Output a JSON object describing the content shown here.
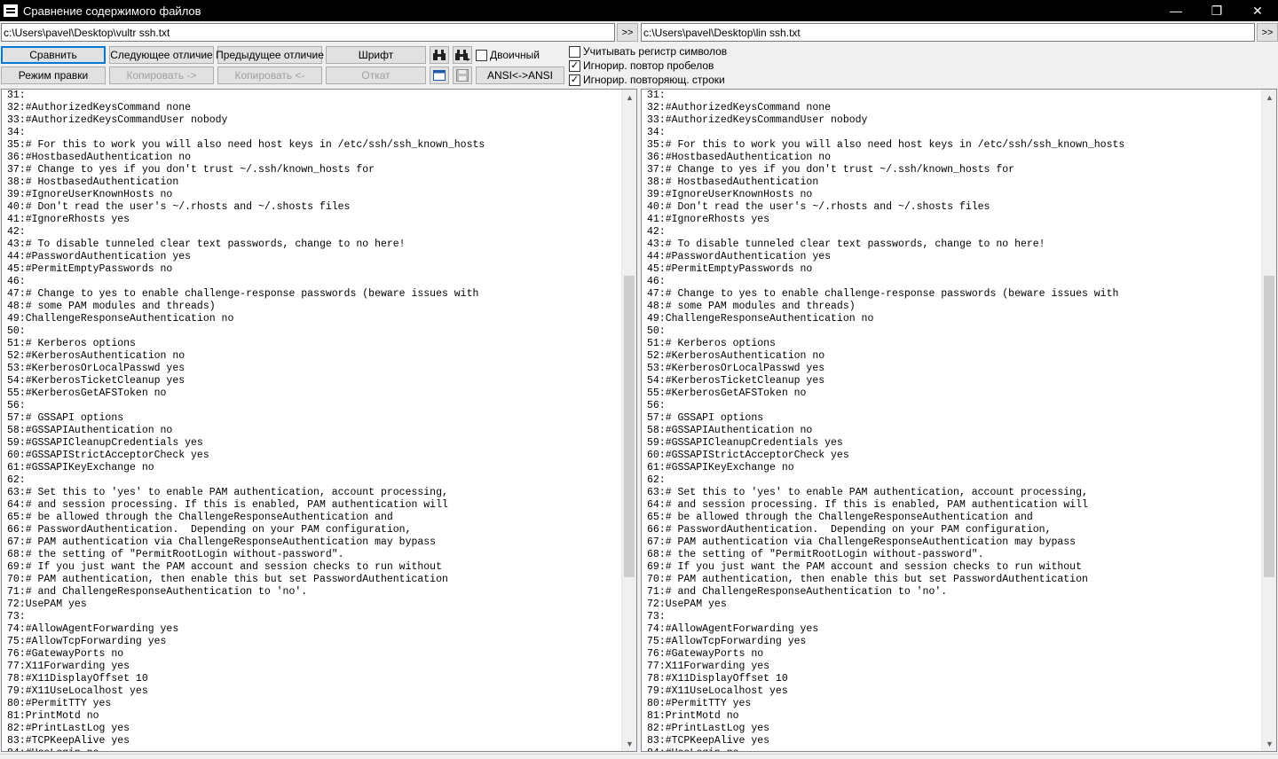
{
  "window": {
    "title": "Сравнение содержимого файлов",
    "min_glyph": "—",
    "max_glyph": "❐",
    "close_glyph": "✕"
  },
  "paths": {
    "left": "c:\\Users\\pavel\\Desktop\\vultr ssh.txt",
    "right": "c:\\Users\\pavel\\Desktop\\lin ssh.txt",
    "browse_label": ">>"
  },
  "toolbar": {
    "compare": "Сравнить",
    "next_diff": "Следующее отличие",
    "prev_diff": "Предыдущее отличие",
    "font": "Шрифт",
    "binary": "Двоичный",
    "edit_mode": "Режим правки",
    "copy_right": "Копировать ->",
    "copy_left": "Копировать <-",
    "undo": "Откат",
    "ansi": "ANSI<->ANSI",
    "find_icon": "binoculars-icon",
    "find_next_icon": "binoculars-next-icon",
    "view_icon": "window-icon",
    "save_icon": "floppy-disk-icon"
  },
  "options": {
    "case_sensitive": {
      "label": "Учитывать регистр символов",
      "checked": false
    },
    "ignore_spaces": {
      "label": "Игнорир. повтор пробелов",
      "checked": true
    },
    "ignore_lines": {
      "label": "Игнорир. повторяющ. строки",
      "checked": true
    }
  },
  "left_text": "31:\n32:#AuthorizedKeysCommand none\n33:#AuthorizedKeysCommandUser nobody\n34:\n35:# For this to work you will also need host keys in /etc/ssh/ssh_known_hosts\n36:#HostbasedAuthentication no\n37:# Change to yes if you don't trust ~/.ssh/known_hosts for\n38:# HostbasedAuthentication\n39:#IgnoreUserKnownHosts no\n40:# Don't read the user's ~/.rhosts and ~/.shosts files\n41:#IgnoreRhosts yes\n42:\n43:# To disable tunneled clear text passwords, change to no here!\n44:#PasswordAuthentication yes\n45:#PermitEmptyPasswords no\n46:\n47:# Change to yes to enable challenge-response passwords (beware issues with\n48:# some PAM modules and threads)\n49:ChallengeResponseAuthentication no\n50:\n51:# Kerberos options\n52:#KerberosAuthentication no\n53:#KerberosOrLocalPasswd yes\n54:#KerberosTicketCleanup yes\n55:#KerberosGetAFSToken no\n56:\n57:# GSSAPI options\n58:#GSSAPIAuthentication no\n59:#GSSAPICleanupCredentials yes\n60:#GSSAPIStrictAcceptorCheck yes\n61:#GSSAPIKeyExchange no\n62:\n63:# Set this to 'yes' to enable PAM authentication, account processing,\n64:# and session processing. If this is enabled, PAM authentication will\n65:# be allowed through the ChallengeResponseAuthentication and\n66:# PasswordAuthentication.  Depending on your PAM configuration,\n67:# PAM authentication via ChallengeResponseAuthentication may bypass\n68:# the setting of \"PermitRootLogin without-password\".\n69:# If you just want the PAM account and session checks to run without\n70:# PAM authentication, then enable this but set PasswordAuthentication\n71:# and ChallengeResponseAuthentication to 'no'.\n72:UsePAM yes\n73:\n74:#AllowAgentForwarding yes\n75:#AllowTcpForwarding yes\n76:#GatewayPorts no\n77:X11Forwarding yes\n78:#X11DisplayOffset 10\n79:#X11UseLocalhost yes\n80:#PermitTTY yes\n81:PrintMotd no\n82:#PrintLastLog yes\n83:#TCPKeepAlive yes\n84:#UseLogin no",
  "right_text": "31:\n32:#AuthorizedKeysCommand none\n33:#AuthorizedKeysCommandUser nobody\n34:\n35:# For this to work you will also need host keys in /etc/ssh/ssh_known_hosts\n36:#HostbasedAuthentication no\n37:# Change to yes if you don't trust ~/.ssh/known_hosts for\n38:# HostbasedAuthentication\n39:#IgnoreUserKnownHosts no\n40:# Don't read the user's ~/.rhosts and ~/.shosts files\n41:#IgnoreRhosts yes\n42:\n43:# To disable tunneled clear text passwords, change to no here!\n44:#PasswordAuthentication yes\n45:#PermitEmptyPasswords no\n46:\n47:# Change to yes to enable challenge-response passwords (beware issues with\n48:# some PAM modules and threads)\n49:ChallengeResponseAuthentication no\n50:\n51:# Kerberos options\n52:#KerberosAuthentication no\n53:#KerberosOrLocalPasswd yes\n54:#KerberosTicketCleanup yes\n55:#KerberosGetAFSToken no\n56:\n57:# GSSAPI options\n58:#GSSAPIAuthentication no\n59:#GSSAPICleanupCredentials yes\n60:#GSSAPIStrictAcceptorCheck yes\n61:#GSSAPIKeyExchange no\n62:\n63:# Set this to 'yes' to enable PAM authentication, account processing,\n64:# and session processing. If this is enabled, PAM authentication will\n65:# be allowed through the ChallengeResponseAuthentication and\n66:# PasswordAuthentication.  Depending on your PAM configuration,\n67:# PAM authentication via ChallengeResponseAuthentication may bypass\n68:# the setting of \"PermitRootLogin without-password\".\n69:# If you just want the PAM account and session checks to run without\n70:# PAM authentication, then enable this but set PasswordAuthentication\n71:# and ChallengeResponseAuthentication to 'no'.\n72:UsePAM yes\n73:\n74:#AllowAgentForwarding yes\n75:#AllowTcpForwarding yes\n76:#GatewayPorts no\n77:X11Forwarding yes\n78:#X11DisplayOffset 10\n79:#X11UseLocalhost yes\n80:#PermitTTY yes\n81:PrintMotd no\n82:#PrintLastLog yes\n83:#TCPKeepAlive yes\n84:#UseLogin no"
}
